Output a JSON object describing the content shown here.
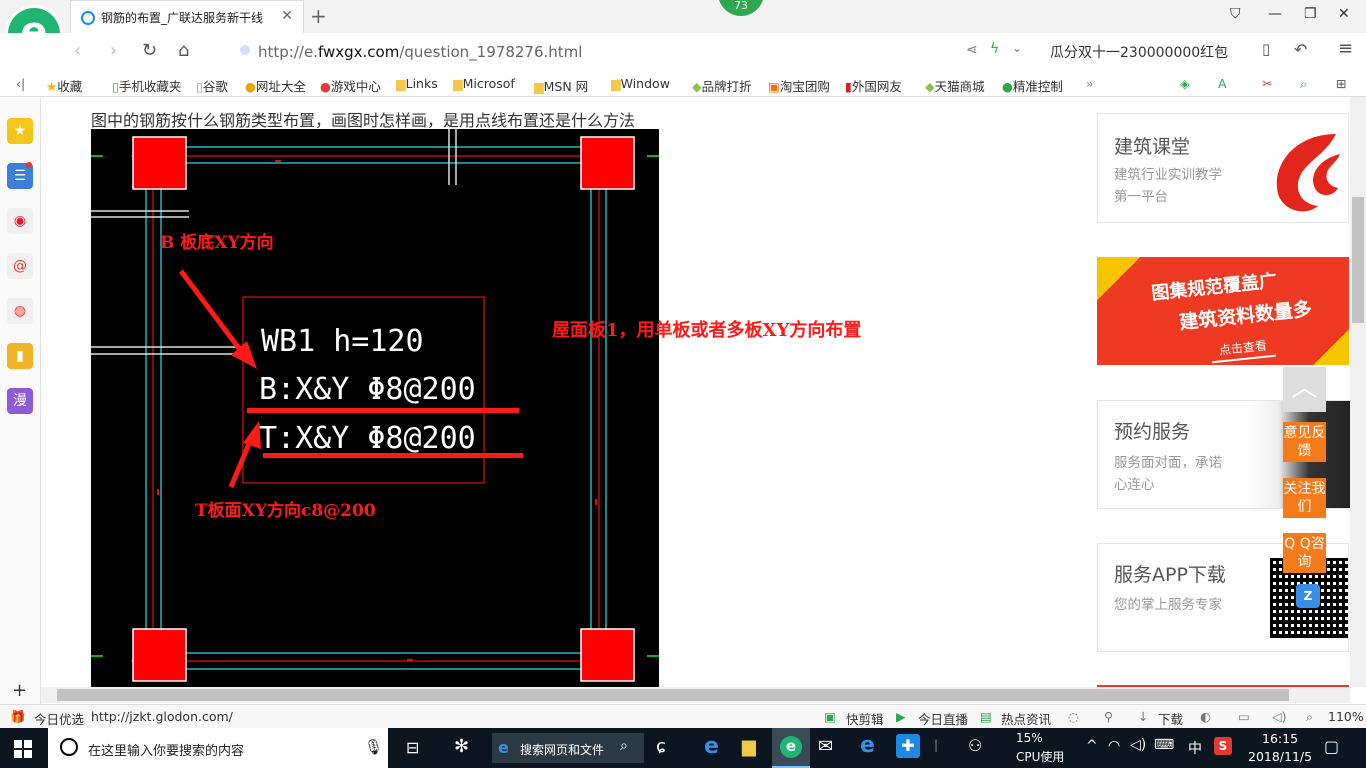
{
  "browser": {
    "tab_title": "钢筋的布置_广联达服务新干线",
    "badge_count": "73",
    "url_prefix": "http://e.",
    "url_domain": "fwxgx.com",
    "url_path": "/question_1978276.html",
    "search_text": "瓜分双十一230000000红包"
  },
  "bookmarks": [
    "收藏",
    "手机收藏夹",
    "谷歌",
    "网址大全",
    "游戏中心",
    "Links",
    "Microsof",
    "MSN 网",
    "Window",
    "品牌打折",
    "淘宝团购",
    "外国网友",
    "天猫商城",
    "精准控制"
  ],
  "question": "图中的钢筋按什么钢筋类型布置，画图时怎样画，是用点线布置还是什么方法",
  "cad": {
    "line1": "WB1 h=120",
    "line2": "B:X&Y Φ8@200",
    "line3": "T:X&Y Φ8@200"
  },
  "annotations": {
    "bottom": "B  板底XY方向",
    "top": "T板面XY方向c8@200",
    "side": "屋面板1，用单板或者多板XY方向布置"
  },
  "right": {
    "card1_title": "建筑课堂",
    "card1_sub": "建筑行业实训教学第一平台",
    "banner_line1": "图集规范覆盖广",
    "banner_line2": "建筑资料数量多",
    "banner_btn": "点击查看",
    "card2_title": "预约服务",
    "card2_sub": "服务面对面，承诺心连心",
    "card3_title": "服务APP下载",
    "card3_sub": "您的掌上服务专家",
    "fb1": "意见反馈",
    "fb2": "关注我们",
    "fb3": "Q Q咨询"
  },
  "status": {
    "left": "今日优选",
    "link": "http://jzkt.glodon.com/",
    "items": [
      "快剪辑",
      "今日直播",
      "热点资讯",
      "下载"
    ],
    "zoom": "110%"
  },
  "taskbar": {
    "search_placeholder": "在这里输入你要搜索的内容",
    "web_search": "搜索网页和文件",
    "cpu_percent": "15%",
    "cpu_label": "CPU使用",
    "ime": "中",
    "time": "16:15",
    "date": "2018/11/5"
  }
}
